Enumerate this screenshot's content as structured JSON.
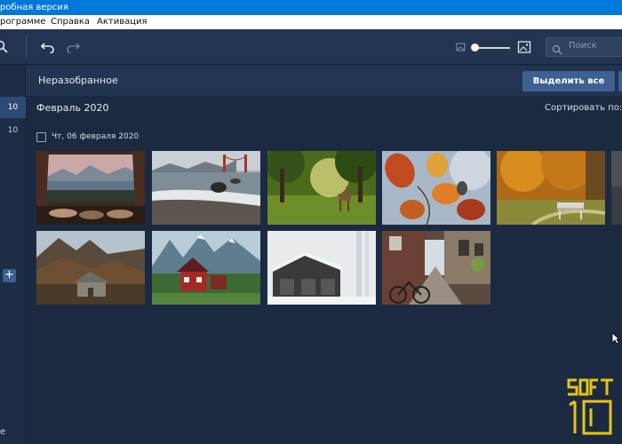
{
  "window": {
    "title": "робная версия"
  },
  "menu": {
    "items": [
      "рограмме",
      "Справка",
      "Активация"
    ]
  },
  "toolbar": {
    "search_placeholder": "Поиск"
  },
  "sidebar": {
    "numbers": [
      "10",
      "10"
    ],
    "bottom_label": "e"
  },
  "header": {
    "title": "Неразобранное",
    "select_all": "Выделить все"
  },
  "gallery": {
    "month": "Февраль 2020",
    "sort_label": "Сортировать по:",
    "date_group": "Чт, 06 февраля 2020",
    "photos": [
      {
        "name": "tent-lake-mountains"
      },
      {
        "name": "beach-golden-gate"
      },
      {
        "name": "deer-in-forest"
      },
      {
        "name": "autumn-leaves"
      },
      {
        "name": "autumn-bench-park"
      },
      {
        "name": "wooden-hut-rocks"
      },
      {
        "name": "red-house-mountains"
      },
      {
        "name": "snowy-barn"
      },
      {
        "name": "street-bicycles"
      }
    ]
  },
  "watermark": {
    "text_top": "SOFT",
    "text_bottom": "10",
    "color": "#e4c51a"
  },
  "colors": {
    "accent": "#3d6191",
    "titlebar": "#0078d7",
    "background": "#1b2a41"
  }
}
